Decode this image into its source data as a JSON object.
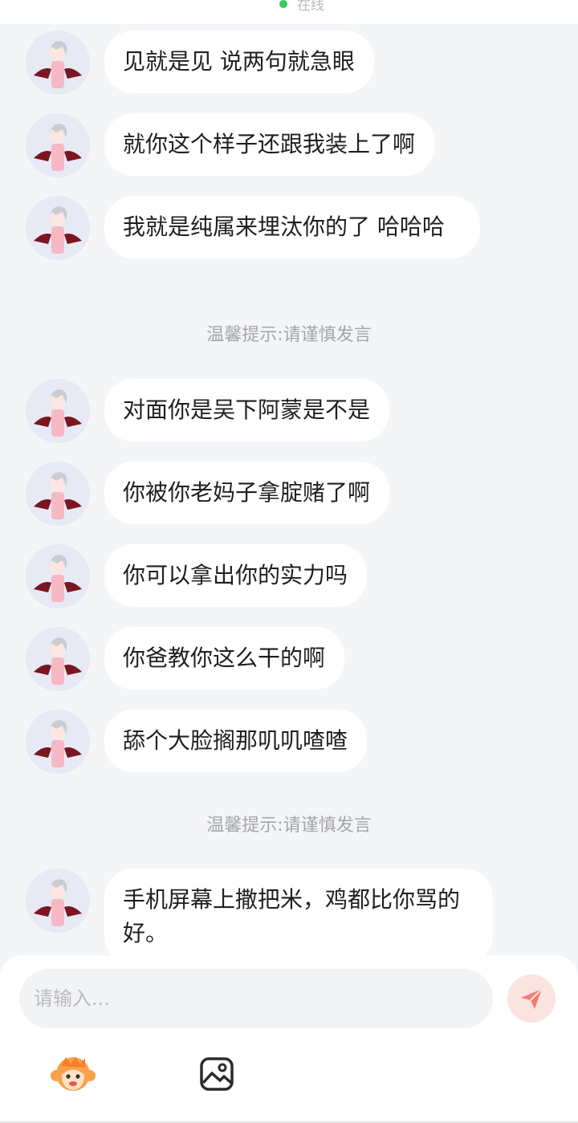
{
  "header": {
    "status_text": "在线",
    "status_color": "#36cc57"
  },
  "messages": [
    {
      "text": "见就是见 说两句就急眼"
    },
    {
      "text": "就你这个样子还跟我装上了啊"
    },
    {
      "text": "我就是纯属来埋汰你的了 哈哈哈"
    },
    {
      "tip": "温馨提示:请谨慎发言"
    },
    {
      "text": "对面你是吴下阿蒙是不是"
    },
    {
      "text": "你被你老妈子拿腚赌了啊"
    },
    {
      "text": "你可以拿出你的实力吗"
    },
    {
      "text": "你爸教你这么干的啊"
    },
    {
      "text": "舔个大脸搁那叽叽喳喳"
    },
    {
      "tip": "温馨提示:请谨慎发言"
    },
    {
      "text": "手机屏幕上撒把米，鸡都比你骂的好。"
    }
  ],
  "input": {
    "placeholder": "请输入..."
  },
  "toolbar": {
    "send_icon": "send-icon",
    "emoji_icon": "emoji-monkey-icon",
    "image_icon": "image-icon"
  },
  "colors": {
    "background": "#f4f5f7",
    "bubble": "#ffffff",
    "tip_text": "#a4a6aa",
    "send_button": "#fbe3e0",
    "send_icon": "#f47b70"
  }
}
